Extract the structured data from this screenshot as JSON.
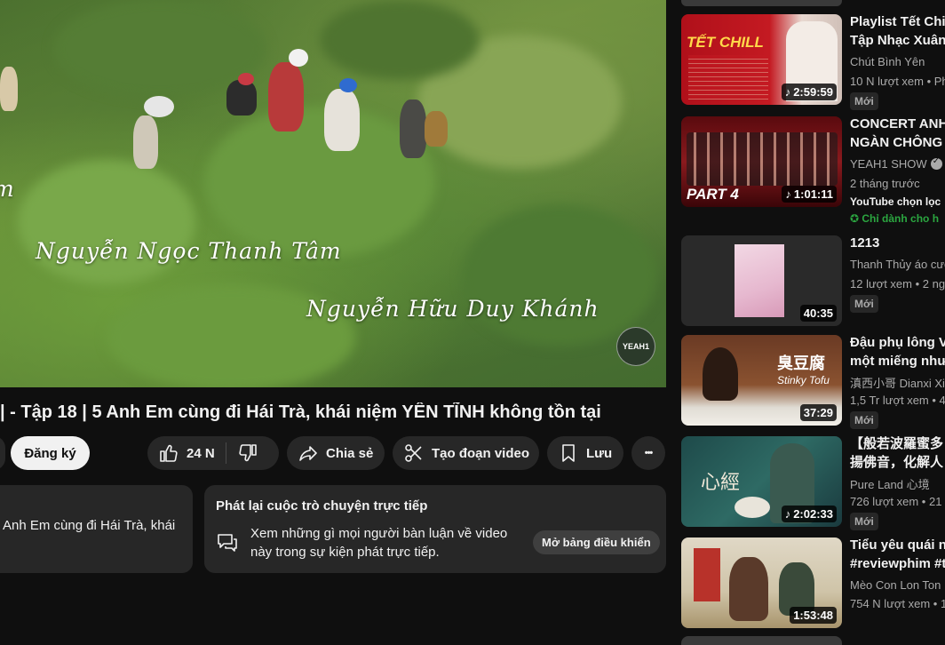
{
  "video": {
    "overlay_name_1": "m",
    "overlay_name_2": "Nguyễn Ngọc Thanh Tâm",
    "overlay_name_3": "Nguyễn Hữu Duy Khánh",
    "logo_text": "YEAH1",
    "title": "| - Tập 18 | 5 Anh Em cùng đi Hái Trà, khái niệm YÊN TĨNH không tồn tại"
  },
  "actions": {
    "subscribe_label": "Đăng ký",
    "like_count": "24 N",
    "share_label": "Chia sẻ",
    "clip_label": "Tạo đoạn video",
    "save_label": "Lưu",
    "more_label": "•••"
  },
  "description": {
    "text": "Anh Em cùng đi Hái Trà, khái"
  },
  "live_chat": {
    "heading": "Phát lại cuộc trò chuyện trực tiếp",
    "body": "Xem những gì mọi người bàn luận về video này trong sự kiện phát trực tiếp.",
    "button_label": "Mở bảng điều khiển"
  },
  "recommendations": [
    {
      "title_line1": "Playlist Tết Chill",
      "title_line2": "Tập Nhạc Xuân",
      "channel": "Chút Bình Yên",
      "stats": "10 N lượt xem • Ph",
      "badge": "Mới",
      "duration": "2:59:59",
      "thumb_text": "TẾT CHILL"
    },
    {
      "title_line1": "CONCERT ANH",
      "title_line2": "NGÀN CHÔNG G",
      "channel": "YEAH1 SHOW",
      "stats": "2 tháng trước",
      "extra": "YouTube chọn lọc",
      "extra2": "Chỉ dành cho h",
      "duration": "1:01:11",
      "thumb_text": "PART 4"
    },
    {
      "title_line1": "1213",
      "channel": "Thanh Thủy áo cướ",
      "stats": "12 lượt xem • 2 ng",
      "badge": "Mới",
      "duration": "40:35"
    },
    {
      "title_line1": "Đậu phụ lông Vâ",
      "title_line2": "một miếng như",
      "channel": "滇西小哥 Dianxi Xia",
      "stats": "1,5 Tr lượt xem • 4",
      "badge": "Mới",
      "duration": "37:29",
      "thumb_text": "臭豆腐",
      "thumb_text2": "Stinky Tofu"
    },
    {
      "title_line1": "【般若波羅蜜多",
      "title_line2": "揚佛音，化解人",
      "channel": "Pure Land 心境",
      "stats": "726 lượt xem • 21",
      "badge": "Mới",
      "duration": "2:02:33",
      "thumb_text": "心經"
    },
    {
      "title_line1": "Tiểu yêu quái nú",
      "title_line2": "#reviewphim #ta",
      "channel": "Mèo Con Lon Ton",
      "stats": "754 N lượt xem • 1",
      "duration": "1:53:48"
    }
  ],
  "colors": {
    "background": "#0f0f0f",
    "pill": "#272727",
    "text": "#f1f1f1",
    "meta": "#aaaaaa",
    "accent_green": "#2ba640"
  }
}
